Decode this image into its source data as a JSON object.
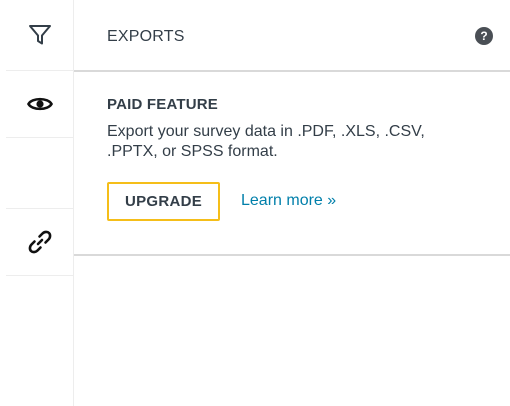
{
  "rail": {
    "items": [
      {
        "icon": "filter-icon"
      },
      {
        "icon": "eye-icon"
      },
      {
        "icon": "link-icon"
      }
    ]
  },
  "header": {
    "title": "EXPORTS",
    "help_icon": "?"
  },
  "feature": {
    "title": "PAID FEATURE",
    "description": "Export your survey data in .PDF, .XLS, .CSV, .PPTX, or SPSS format.",
    "upgrade_label": "UPGRADE",
    "learn_more_label": "Learn more »"
  },
  "colors": {
    "accent_border": "#f5be19",
    "link": "#007faa",
    "text": "#333e48"
  }
}
